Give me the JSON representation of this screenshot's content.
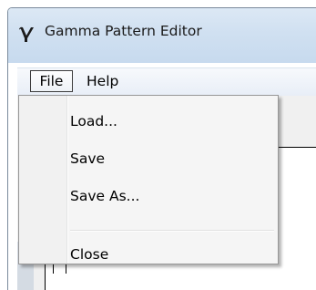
{
  "window": {
    "title": "Gamma Pattern Editor",
    "app_icon": "gamma-letter-icon"
  },
  "menubar": {
    "items": [
      {
        "label": "File",
        "active": true
      },
      {
        "label": "Help",
        "active": false
      }
    ]
  },
  "file_menu": {
    "items": [
      {
        "label": "Load..."
      },
      {
        "label": "Save"
      },
      {
        "label": "Save As..."
      },
      {
        "separator": true
      },
      {
        "label": "Close"
      }
    ]
  }
}
